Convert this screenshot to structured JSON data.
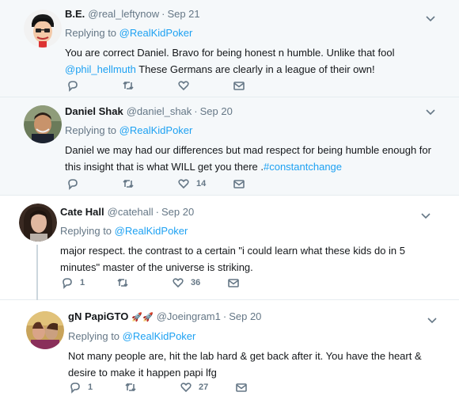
{
  "tweets": [
    {
      "name": "B.E.",
      "handle": "@real_leftynow",
      "date": "Sep 21",
      "reply_prefix": "Replying to",
      "reply_to": "@RealKidPoker",
      "text_parts": [
        "You are correct Daniel. Bravo for being honest n humble. Unlike that fool ",
        "@phil_hellmuth",
        " These Germans are clearly in a league of their own!"
      ],
      "replies": "",
      "retweets": "",
      "likes": ""
    },
    {
      "name": "Daniel Shak",
      "handle": "@daniel_shak",
      "date": "Sep 20",
      "reply_prefix": "Replying to",
      "reply_to": "@RealKidPoker",
      "text_parts": [
        "Daniel we may had our differences but mad respect for  being humble enough for this insight that is what WILL get you there .",
        "#constantchange",
        ""
      ],
      "replies": "",
      "retweets": "",
      "likes": "14"
    },
    {
      "name": "Cate Hall",
      "handle": "@catehall",
      "date": "Sep 20",
      "reply_prefix": "Replying to",
      "reply_to": "@RealKidPoker",
      "text_parts": [
        "major respect. the contrast to a certain \"i could learn what these kids do in 5 minutes\" master of the universe is striking.",
        "",
        ""
      ],
      "replies": "1",
      "retweets": "",
      "likes": "36"
    },
    {
      "name": "gN PapiGTO",
      "emoji": "🚀🚀",
      "handle": "@Joeingram1",
      "date": "Sep 20",
      "reply_prefix": "Replying to",
      "reply_to": "@RealKidPoker",
      "text_parts": [
        "Not many people are, hit the lab hard & get back after it. You have the heart & desire to make it happen papi lfg",
        "",
        ""
      ],
      "replies": "1",
      "retweets": "",
      "likes": "27"
    }
  ],
  "colors": {
    "link": "#1da1f2",
    "muted": "#657786",
    "highlight_bg": "#f5f8fa"
  },
  "icons": [
    "reply-icon",
    "retweet-icon",
    "like-icon",
    "direct-message-icon",
    "chevron-down-icon"
  ]
}
